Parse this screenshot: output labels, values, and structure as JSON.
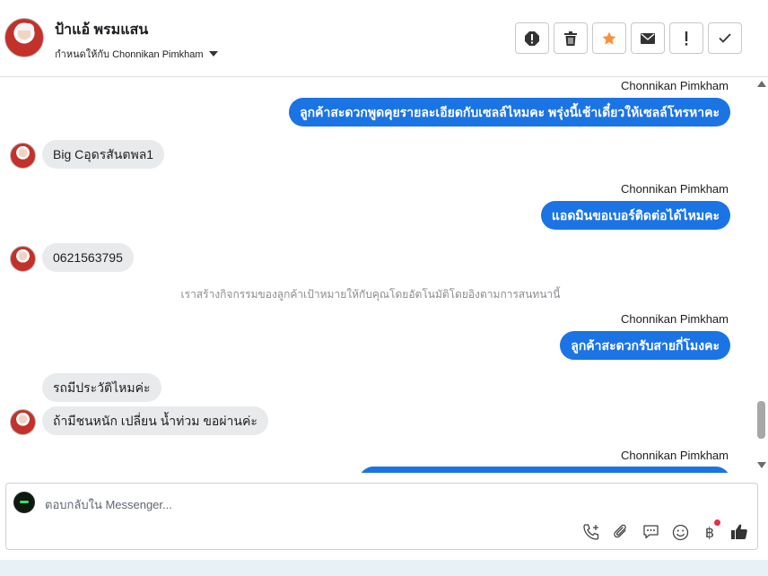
{
  "header": {
    "contact_name": "ป้าแอ้ พรมแสน",
    "assigned_text": "กำหนดให้กับ Chonnikan Pimkham",
    "actions": [
      {
        "name": "spam-icon"
      },
      {
        "name": "trash-icon"
      },
      {
        "name": "star-icon",
        "color": "#f7923b"
      },
      {
        "name": "envelope-icon"
      },
      {
        "name": "exclamation-icon"
      },
      {
        "name": "checkmark-icon"
      }
    ]
  },
  "messages": [
    {
      "type": "outgoing",
      "sender": "Chonnikan Pimkham",
      "text": "ลูกค้าสะดวกพูดคุยรายละเอียดกับเซลล์ไหมคะ พรุ่งนี้เช้าเดี๋ยวให้เซลล์โทรหาคะ"
    },
    {
      "type": "incoming",
      "text": "Big Cอุดรสันตพล1"
    },
    {
      "type": "outgoing",
      "sender": "Chonnikan Pimkham",
      "text": "แอดมินขอเบอร์ติดต่อได้ไหมคะ"
    },
    {
      "type": "incoming",
      "text": "0621563795"
    },
    {
      "type": "system",
      "text": "เราสร้างกิจกรรมของลูกค้าเป้าหมายให้กับคุณโดยอัตโนมัติโดยอิงตามการสนทนานี้"
    },
    {
      "type": "outgoing",
      "sender": "Chonnikan Pimkham",
      "text": "ลูกค้าสะดวกรับสายกี่โมงคะ"
    },
    {
      "type": "incoming",
      "text": "รถมีประวัติไหมค่ะ"
    },
    {
      "type": "incoming",
      "text": "ถ้ามีชนหนัก เปลี่ยน น้ำท่วม ขอผ่านค่ะ"
    },
    {
      "type": "outgoing",
      "sender": "Chonnikan Pimkham",
      "text": ""
    }
  ],
  "composer": {
    "placeholder": "ตอบกลับใน Messenger...",
    "tools": [
      "phone-plus-icon",
      "paperclip-icon",
      "chat-bubble-icon",
      "smiley-icon",
      "baht-icon",
      "thumbs-up-icon"
    ],
    "baht_symbol": "฿"
  },
  "colors": {
    "accent": "#1b74e4",
    "incoming_bubble": "#e9eaec",
    "badge_red": "#f0284a"
  }
}
